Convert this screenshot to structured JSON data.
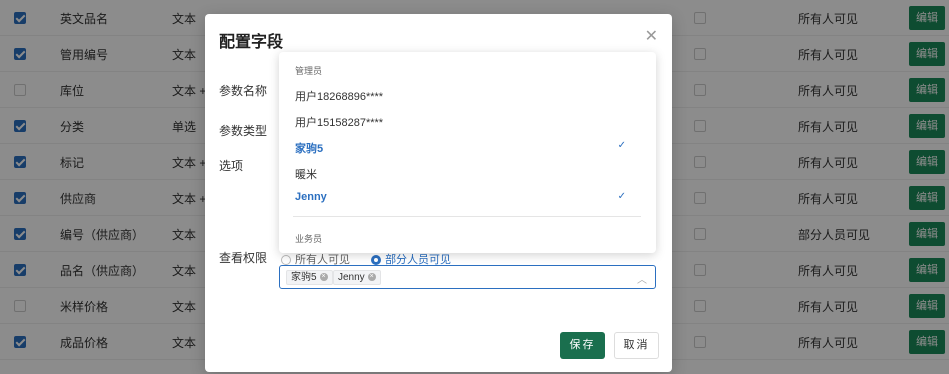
{
  "table": {
    "rows": [
      {
        "name": "英文品名",
        "type": "文本",
        "checked": true,
        "perm": "所有人可见",
        "edit": "编辑"
      },
      {
        "name": "管用编号",
        "type": "文本",
        "checked": true,
        "perm": "所有人可见",
        "edit": "编辑"
      },
      {
        "name": "库位",
        "type": "文本 +",
        "checked": false,
        "perm": "所有人可见",
        "edit": "编辑"
      },
      {
        "name": "分类",
        "type": "单选",
        "checked": true,
        "perm": "所有人可见",
        "edit": "编辑"
      },
      {
        "name": "标记",
        "type": "文本 +",
        "checked": true,
        "perm": "所有人可见",
        "edit": "编辑"
      },
      {
        "name": "供应商",
        "type": "文本 +",
        "checked": true,
        "perm": "所有人可见",
        "edit": "编辑"
      },
      {
        "name": "编号（供应商）",
        "type": "文本",
        "checked": true,
        "perm": "部分人员可见",
        "edit": "编辑"
      },
      {
        "name": "品名（供应商）",
        "type": "文本",
        "checked": true,
        "perm": "所有人可见",
        "edit": "编辑"
      },
      {
        "name": "米样价格",
        "type": "文本",
        "checked": false,
        "perm": "所有人可见",
        "edit": "编辑"
      },
      {
        "name": "成品价格",
        "type": "文本",
        "checked": true,
        "perm": "所有人可见",
        "edit": "编辑"
      }
    ]
  },
  "modal": {
    "title": "配置字段",
    "close_icon": "close-icon",
    "labels": {
      "param_name": "参数名称",
      "param_type": "参数类型",
      "options": "选项",
      "view_perm": "查看权限"
    },
    "radio_all": "所有人可见",
    "radio_partial": "部分人员可见",
    "selected_tags": [
      "家驹5",
      "Jenny"
    ],
    "save_label": "保存",
    "cancel_label": "取消"
  },
  "dropdown": {
    "group1": "管理员",
    "items": [
      {
        "label": "用户18268896****",
        "selected": false
      },
      {
        "label": "用户15158287****",
        "selected": false
      },
      {
        "label": "家驹5",
        "selected": true
      },
      {
        "label": "暖米",
        "selected": false
      },
      {
        "label": "Jenny",
        "selected": true
      }
    ],
    "group2": "业务员",
    "check_glyph": "✓"
  },
  "colors": {
    "accent_blue": "#2b6fc0",
    "save_green": "#1a6f4e",
    "edit_green": "#1a8a5a"
  }
}
